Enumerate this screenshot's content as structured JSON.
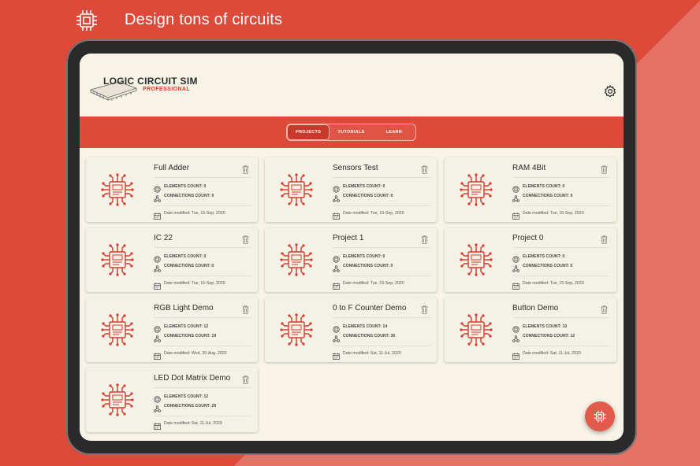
{
  "banner": {
    "title": "Design tons of circuits"
  },
  "app": {
    "title": "LOGIC CIRCUIT SIM",
    "subtitle": "PROFESSIONAL"
  },
  "tabs": [
    {
      "label": "PROJECTS",
      "active": true
    },
    {
      "label": "TUTORIALS",
      "active": false
    },
    {
      "label": "LEARN",
      "active": false
    }
  ],
  "projects": [
    {
      "name": "Full Adder",
      "elements": "ELEMENTS COUNT: 0",
      "connections": "CONNECTIONS COUNT: 0",
      "date": "Date modified: Tue, 15-Sep, 2020"
    },
    {
      "name": "Sensors Test",
      "elements": "ELEMENTS COUNT: 0",
      "connections": "CONNECTIONS COUNT: 0",
      "date": "Date modified: Tue, 15-Sep, 2020"
    },
    {
      "name": "RAM 4Bit",
      "elements": "ELEMENTS COUNT: 0",
      "connections": "CONNECTIONS COUNT: 0",
      "date": "Date modified: Tue, 15-Sep, 2020"
    },
    {
      "name": "IC 22",
      "elements": "ELEMENTS COUNT: 0",
      "connections": "CONNECTIONS COUNT: 0",
      "date": "Date modified: Tue, 15-Sep, 2020"
    },
    {
      "name": "Project 1",
      "elements": "ELEMENTS COUNT: 0",
      "connections": "CONNECTIONS COUNT: 0",
      "date": "Date modified: Tue, 15-Sep, 2020"
    },
    {
      "name": "Project 0",
      "elements": "ELEMENTS COUNT: 0",
      "connections": "CONNECTIONS COUNT: 0",
      "date": "Date modified: Tue, 15-Sep, 2020"
    },
    {
      "name": "RGB Light Demo",
      "elements": "ELEMENTS COUNT: 12",
      "connections": "CONNECTIONS COUNT: 19",
      "date": "Date modified: Wed, 26-Aug, 2020"
    },
    {
      "name": "0 to F Counter Demo",
      "elements": "ELEMENTS COUNT: 14",
      "connections": "CONNECTIONS COUNT: 30",
      "date": "Date modified: Sat, 11-Jul, 2020"
    },
    {
      "name": "Button Demo",
      "elements": "ELEMENTS COUNT: 10",
      "connections": "CONNECTIONS COUNT: 12",
      "date": "Date modified: Sat, 11-Jul, 2020"
    },
    {
      "name": "LED Dot Matrix Demo",
      "elements": "ELEMENTS COUNT: 12",
      "connections": "CONNECTIONS COUNT: 29",
      "date": "Date modified: Sat, 11-Jul, 2020"
    }
  ],
  "icons": {
    "banner": "chip-icon",
    "settings": "gear-icon",
    "delete": "trash-icon",
    "elements": "element-icon",
    "connections": "connection-icon",
    "date": "calendar-icon",
    "fab": "chip-icon"
  },
  "colors": {
    "brand": "#de4a3a",
    "screen": "#f7f3e7",
    "card": "#f4f1e6"
  }
}
